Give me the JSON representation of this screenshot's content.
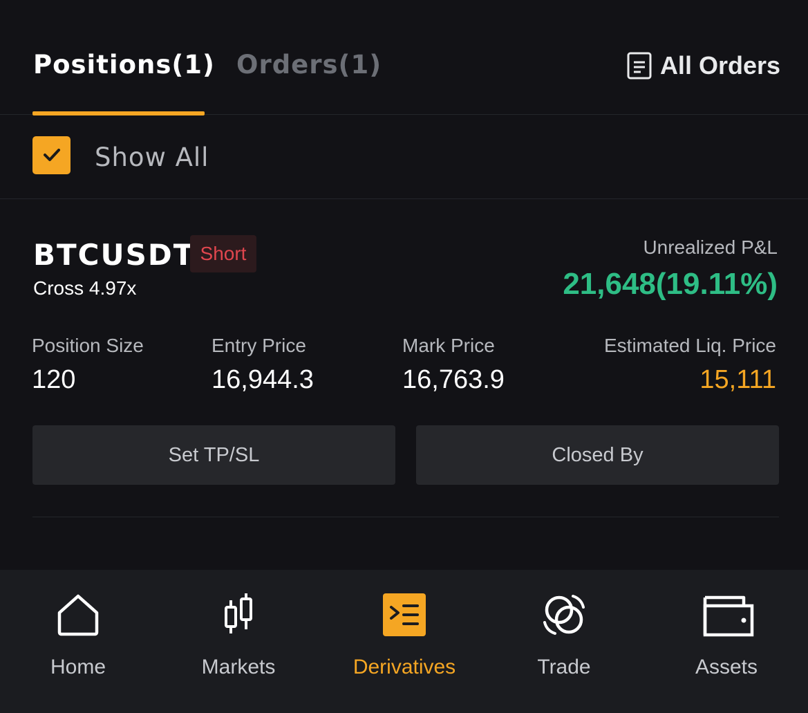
{
  "tabs": {
    "positions_label": "Positions(1)",
    "orders_label": "Orders(1)",
    "all_orders_label": "All Orders",
    "active": "positions"
  },
  "filter": {
    "show_all_label": "Show All",
    "show_all_checked": true
  },
  "position": {
    "symbol": "BTCUSDT",
    "side": "Short",
    "margin_mode": "Cross 4.97x",
    "unrealized_pnl_label": "Unrealized P&L",
    "unrealized_pnl_value": "21,648(19.11%)",
    "stats": {
      "size_label": "Position Size",
      "size_value": "120",
      "entry_label": "Entry Price",
      "entry_value": "16,944.3",
      "mark_label": "Mark Price",
      "mark_value": "16,763.9",
      "liq_label": "Estimated Liq. Price",
      "liq_value": "15,111"
    },
    "actions": {
      "tpsl_label": "Set TP/SL",
      "closed_by_label": "Closed By"
    }
  },
  "bottom_nav": {
    "items": [
      {
        "label": "Home",
        "icon": "home-icon"
      },
      {
        "label": "Markets",
        "icon": "candlestick-icon"
      },
      {
        "label": "Derivatives",
        "icon": "derivatives-icon"
      },
      {
        "label": "Trade",
        "icon": "trade-icon"
      },
      {
        "label": "Assets",
        "icon": "wallet-icon"
      }
    ],
    "active_index": 2
  },
  "colors": {
    "accent": "#f5a623",
    "positive": "#2ebd85",
    "negative": "#e0464e",
    "background": "#121216",
    "nav_background": "#1b1c20"
  }
}
